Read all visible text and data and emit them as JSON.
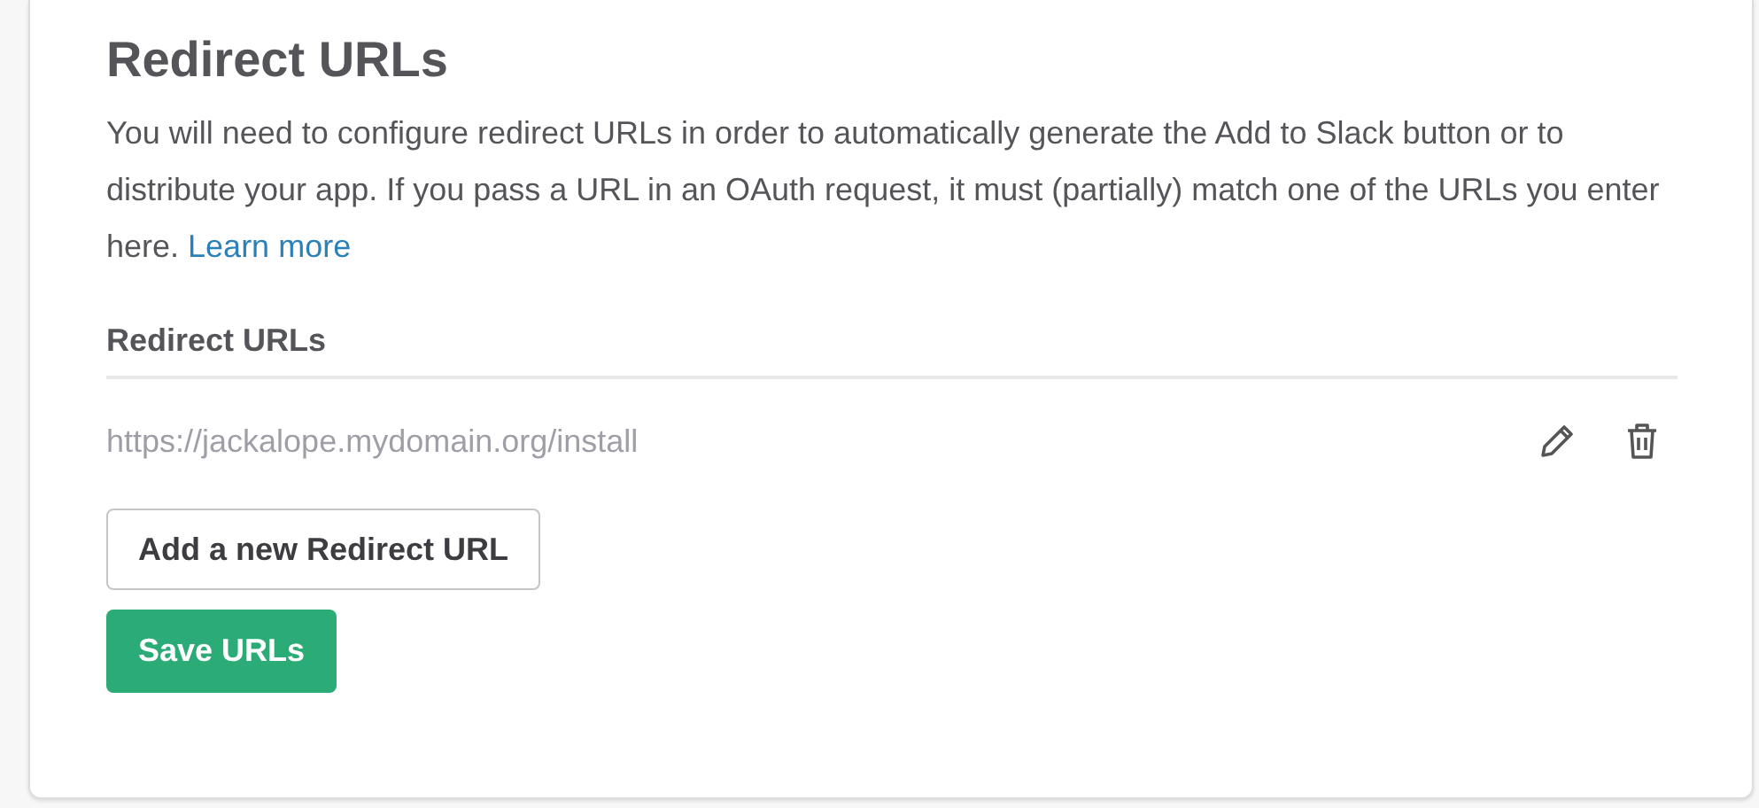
{
  "title": "Redirect URLs",
  "description": "You will need to configure redirect URLs in order to automatically generate the Add to Slack button or to distribute your app. If you pass a URL in an OAuth request, it must (partially) match one of the URLs you enter here.",
  "learn_more_link": "Learn more",
  "list_heading": "Redirect URLs",
  "urls": [
    {
      "url": "https://jackalope.mydomain.org/install"
    }
  ],
  "add_button": "Add a new Redirect URL",
  "save_button": "Save URLs"
}
